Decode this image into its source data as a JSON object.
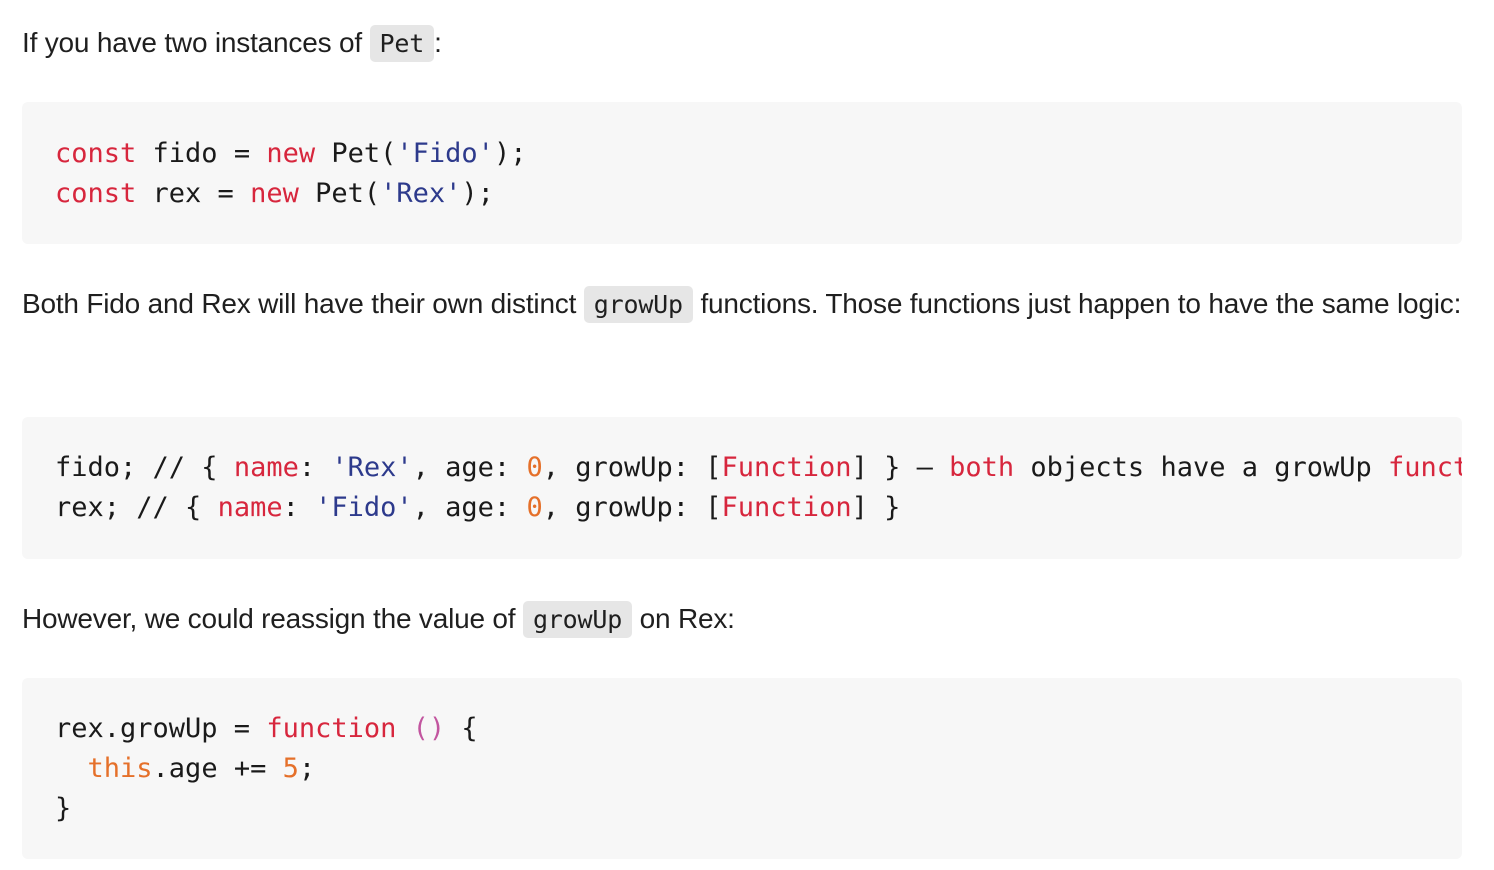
{
  "para1": {
    "before": "If you have two instances of ",
    "code": "Pet",
    "after": ":"
  },
  "block1": {
    "line1": {
      "kw1": "const",
      "t1": " fido = ",
      "kw2": "new",
      "t2": " Pet(",
      "str": "'Fido'",
      "t3": ");"
    },
    "line2": {
      "kw1": "const",
      "t1": " rex = ",
      "kw2": "new",
      "t2": " Pet(",
      "str": "'Rex'",
      "t3": ");"
    }
  },
  "para2": {
    "before": "Both Fido and Rex will have their own distinct ",
    "code": "growUp",
    "after": " functions. Those functions just happen to have the same logic:"
  },
  "block2": {
    "line1": {
      "t1": "fido; // { ",
      "p1": "name",
      "t2": ": ",
      "s1": "'Rex'",
      "t3": ", age: ",
      "n1": "0",
      "t4": ", growUp: [",
      "p2": "Function",
      "t5": "] } – ",
      "p3": "both",
      "t6": " objects have a growUp ",
      "p4": "function"
    },
    "line2": {
      "t1": "rex; // { ",
      "p1": "name",
      "t2": ": ",
      "s1": "'Fido'",
      "t3": ", age: ",
      "n1": "0",
      "t4": ", growUp: [",
      "p2": "Function",
      "t5": "] }"
    }
  },
  "para3": {
    "before": "However, we could reassign the value of ",
    "code": "growUp",
    "after": " on Rex:"
  },
  "block3": {
    "line1": {
      "t1": "rex.growUp = ",
      "kw": "function",
      "sp": " ",
      "paren": "()",
      "t2": " {"
    },
    "line2": {
      "indent": "  ",
      "kw": "this",
      "t1": ".age += ",
      "num": "5",
      "t2": ";"
    },
    "line3": {
      "t1": "}"
    }
  }
}
